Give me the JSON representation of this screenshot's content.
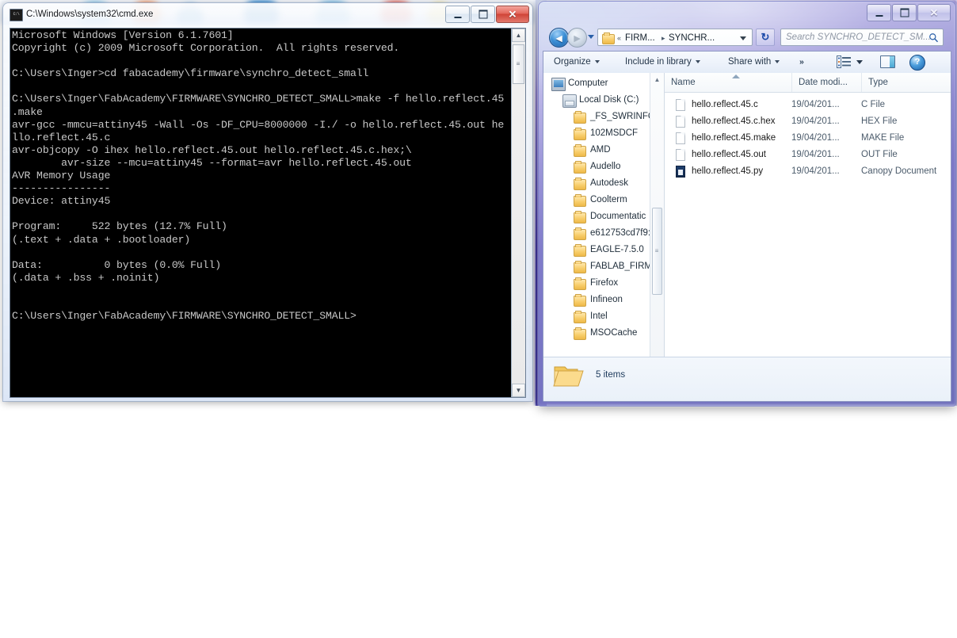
{
  "desktop": {
    "background_color": "#ffffff",
    "wallpaper_accent": "#3a2f9e"
  },
  "cmd_window": {
    "icon": "cmd-icon",
    "title": "C:\\Windows\\system32\\cmd.exe",
    "titlebar_icon_text": "C:\\",
    "buttons": {
      "minimize": "minimize-button",
      "maximize": "maximize-button",
      "close": "✕"
    },
    "console_text": "Microsoft Windows [Version 6.1.7601]\nCopyright (c) 2009 Microsoft Corporation.  All rights reserved.\n\nC:\\Users\\Inger>cd fabacademy\\firmware\\synchro_detect_small\n\nC:\\Users\\Inger\\FabAcademy\\FIRMWARE\\SYNCHRO_DETECT_SMALL>make -f hello.reflect.45\n.make\navr-gcc -mmcu=attiny45 -Wall -Os -DF_CPU=8000000 -I./ -o hello.reflect.45.out he\nllo.reflect.45.c\navr-objcopy -O ihex hello.reflect.45.out hello.reflect.45.c.hex;\\\n        avr-size --mcu=attiny45 --format=avr hello.reflect.45.out\nAVR Memory Usage\n----------------\nDevice: attiny45\n\nProgram:     522 bytes (12.7% Full)\n(.text + .data + .bootloader)\n\nData:          0 bytes (0.0% Full)\n(.data + .bss + .noinit)\n\n\nC:\\Users\\Inger\\FabAcademy\\FIRMWARE\\SYNCHRO_DETECT_SMALL>",
    "scrollbar": {
      "up_arrow": "▲",
      "down_arrow": "▼",
      "thumb_grip": "≡"
    }
  },
  "explorer_window": {
    "buttons": {
      "minimize": "minimize-button",
      "maximize": "maximize-button",
      "close": "✕"
    },
    "navigation": {
      "back_label": "◄",
      "forward_label": "►",
      "recent_pages_label": "recent-pages-dropdown",
      "breadcrumbs": [
        {
          "label": "FIRM...",
          "separator": "«"
        },
        {
          "label": "SYNCHR...",
          "separator": "▸"
        }
      ],
      "address_dropdown": "address-dropdown",
      "refresh_label": "↻",
      "search_placeholder": "Search SYNCHRO_DETECT_SM..."
    },
    "toolbar": {
      "organize": "Organize",
      "include_in_library": "Include in library",
      "share_with": "Share with",
      "overflow": "»",
      "views_icon": "views-icon",
      "preview_pane_icon": "preview-pane-icon",
      "help_icon": "?"
    },
    "nav_tree": [
      {
        "label": "Computer",
        "icon": "computer-icon",
        "indent": 0
      },
      {
        "label": "Local Disk (C:)",
        "icon": "disk-icon",
        "indent": 1
      },
      {
        "label": "_FS_SWRINFO",
        "icon": "folder-icon",
        "indent": 2
      },
      {
        "label": "102MSDCF",
        "icon": "folder-icon",
        "indent": 2
      },
      {
        "label": "AMD",
        "icon": "folder-icon",
        "indent": 2
      },
      {
        "label": "Audello",
        "icon": "folder-icon",
        "indent": 2
      },
      {
        "label": "Autodesk",
        "icon": "folder-icon",
        "indent": 2
      },
      {
        "label": "Coolterm",
        "icon": "folder-icon",
        "indent": 2
      },
      {
        "label": "Documentatic",
        "icon": "folder-icon",
        "indent": 2
      },
      {
        "label": "e612753cd7f9:",
        "icon": "folder-icon",
        "indent": 2
      },
      {
        "label": "EAGLE-7.5.0",
        "icon": "folder-icon",
        "indent": 2
      },
      {
        "label": "FABLAB_FIRM",
        "icon": "folder-icon",
        "indent": 2
      },
      {
        "label": "Firefox",
        "icon": "folder-icon",
        "indent": 2
      },
      {
        "label": "Infineon",
        "icon": "folder-icon",
        "indent": 2
      },
      {
        "label": "Intel",
        "icon": "folder-icon",
        "indent": 2
      },
      {
        "label": "MSOCache",
        "icon": "folder-icon",
        "indent": 2
      }
    ],
    "columns": [
      {
        "label": "Name"
      },
      {
        "label": "Date modi..."
      },
      {
        "label": "Type"
      }
    ],
    "files": [
      {
        "name": "hello.reflect.45.c",
        "date": "19/04/201...",
        "type": "C File",
        "icon": "file-icon"
      },
      {
        "name": "hello.reflect.45.c.hex",
        "date": "19/04/201...",
        "type": "HEX File",
        "icon": "file-icon"
      },
      {
        "name": "hello.reflect.45.make",
        "date": "19/04/201...",
        "type": "MAKE File",
        "icon": "file-icon"
      },
      {
        "name": "hello.reflect.45.out",
        "date": "19/04/201...",
        "type": "OUT File",
        "icon": "file-icon"
      },
      {
        "name": "hello.reflect.45.py",
        "date": "19/04/201...",
        "type": "Canopy Document",
        "icon": "canopy-icon"
      }
    ],
    "status": {
      "item_count": "5 items",
      "folder_icon": "open-folder-icon"
    },
    "scrollbars": {
      "nav_up": "▲",
      "nav_down": "▼",
      "nav_grip": "≡",
      "h_left": "◄",
      "h_right": "►",
      "h_grip": "⦀"
    }
  }
}
